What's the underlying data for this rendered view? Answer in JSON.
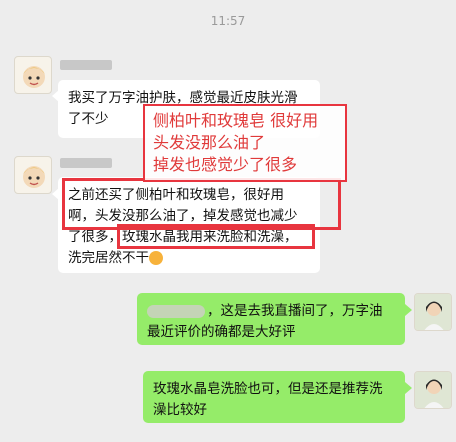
{
  "header": {
    "time": "11:57"
  },
  "messages": [
    {
      "side": "left",
      "text": "我买了万字油护肤，感觉最近皮肤光滑了不少"
    },
    {
      "side": "left",
      "text": "之前还买了侧柏叶和玫瑰皂，很好用啊，头发没那么油了，掉发感觉也减少了很多，玫瑰水晶我用来洗脸和洗澡，洗完居然不干",
      "emoji": "grinning-face-emoji"
    },
    {
      "side": "right",
      "text": "，这是去我直播间了，万字油最近评价的确都是大好评"
    },
    {
      "side": "right",
      "text": "玫瑰水晶皂洗脸也可，但是还是推荐洗澡比较好"
    }
  ],
  "annotation": {
    "lines": [
      "侧柏叶和玫瑰皂 很好用",
      "头发没那么油了",
      "掉发也感觉少了很多"
    ]
  },
  "colors": {
    "highlight_red": "#e8353f",
    "bubble_green": "#95ec69",
    "background": "#ededed"
  }
}
